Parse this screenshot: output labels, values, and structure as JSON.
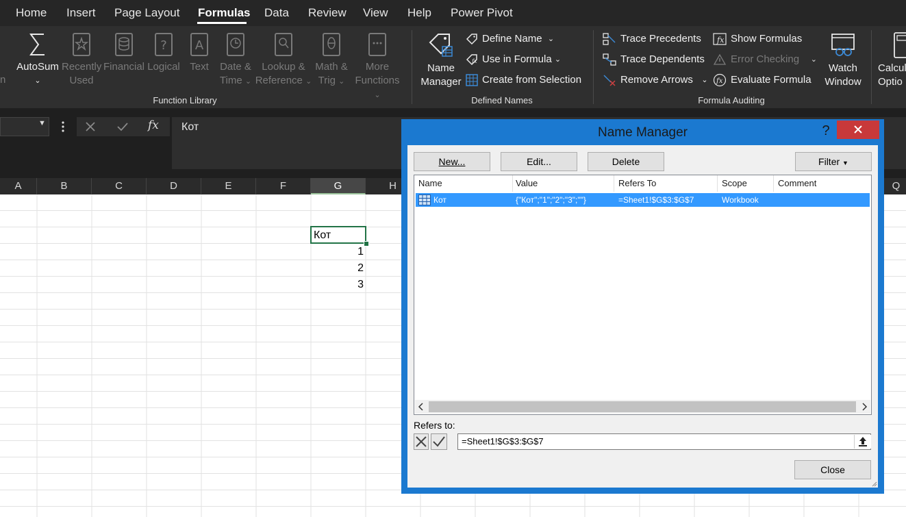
{
  "ribbon": {
    "tabs": [
      "Home",
      "Insert",
      "Page Layout",
      "Formulas",
      "Data",
      "Review",
      "View",
      "Help",
      "Power Pivot"
    ],
    "active_tab": "Formulas",
    "function_library": {
      "autosum": "AutoSum",
      "recently_l1": "Recently",
      "recently_l2": "Used",
      "financial": "Financial",
      "logical": "Logical",
      "text": "Text",
      "date_l1": "Date &",
      "date_l2": "Time",
      "lookup_l1": "Lookup &",
      "lookup_l2": "Reference",
      "math_l1": "Math &",
      "math_l2": "Trig",
      "more_l1": "More",
      "more_l2": "Functions",
      "group_label": "Function Library",
      "left_cut": "n"
    },
    "defined_names": {
      "name_manager_l1": "Name",
      "name_manager_l2": "Manager",
      "define_name": "Define Name",
      "use_in_formula": "Use in Formula",
      "create_from_selection": "Create from Selection",
      "group_label": "Defined Names"
    },
    "formula_auditing": {
      "trace_precedents": "Trace Precedents",
      "trace_dependents": "Trace Dependents",
      "remove_arrows": "Remove Arrows",
      "show_formulas": "Show Formulas",
      "error_checking": "Error Checking",
      "evaluate_formula": "Evaluate Formula",
      "watch_l1": "Watch",
      "watch_l2": "Window",
      "group_label": "Formula Auditing"
    },
    "calc": {
      "l1": "Calcul",
      "l2": "Optio"
    }
  },
  "formula_bar": {
    "value": "Кот",
    "fx": "fx"
  },
  "sheet": {
    "columns": [
      "A",
      "B",
      "C",
      "D",
      "E",
      "F",
      "G",
      "H",
      "Q"
    ],
    "selected_column": "G",
    "cells": {
      "G3": "Кот",
      "G4": "1",
      "G5": "2",
      "G6": "3"
    }
  },
  "dialog": {
    "title": "Name Manager",
    "help": "?",
    "buttons": {
      "new": "New...",
      "edit": "Edit...",
      "delete": "Delete",
      "filter": "Filter",
      "close": "Close"
    },
    "columns": [
      "Name",
      "Value",
      "Refers To",
      "Scope",
      "Comment"
    ],
    "rows": [
      {
        "name": "Кот",
        "value": "{\"Кот\";\"1\";\"2\";\"3\";\"\"}",
        "refers_to": "=Sheet1!$G$3:$G$7",
        "scope": "Workbook",
        "comment": ""
      }
    ],
    "refers_to_label": "Refers to:",
    "refers_to_value": "=Sheet1!$G$3:$G$7"
  },
  "colors": {
    "dialog_border": "#1b79d0",
    "selection": "#3399ff",
    "close_red": "#c8393a",
    "ribbon_bg": "#2f2f2f"
  }
}
